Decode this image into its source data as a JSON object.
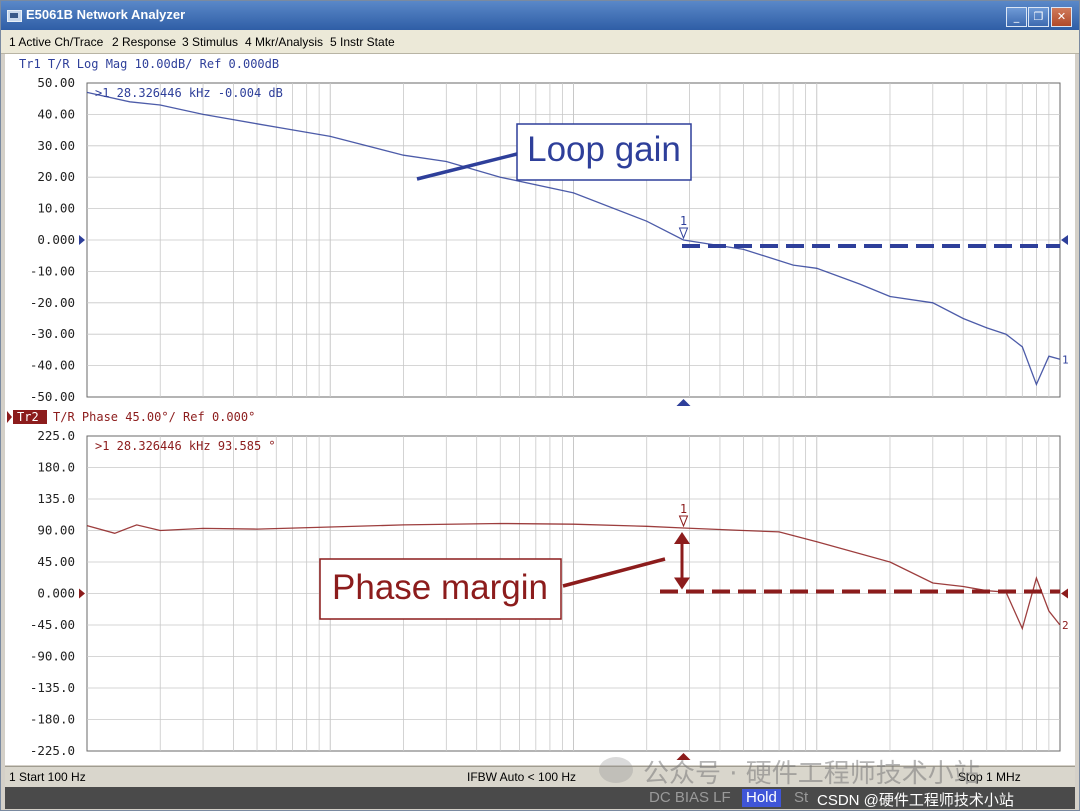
{
  "window": {
    "title": "E5061B Network Analyzer"
  },
  "menu": [
    "1 Active Ch/Trace",
    "2 Response",
    "3 Stimulus",
    "4 Mkr/Analysis",
    "5 Instr State"
  ],
  "colors": {
    "trace1": "#2e3f9a",
    "trace2": "#8c1c1c",
    "grid": "#c8c8c8"
  },
  "trace1": {
    "header": "Tr1 T/R Log Mag 10.00dB/ Ref 0.000dB",
    "marker_readout": ">1  28.326446 kHz  -0.004 dB",
    "y_ticks": [
      "50.00",
      "40.00",
      "30.00",
      "20.00",
      "10.00",
      "0.000",
      "-10.00",
      "-20.00",
      "-30.00",
      "-40.00",
      "-50.00"
    ],
    "marker_label": "1",
    "end_label": "1",
    "callout": "Loop gain"
  },
  "trace2": {
    "header_tag": "Tr2",
    "header": "T/R Phase 45.00°/ Ref 0.000°",
    "marker_readout": ">1  28.326446 kHz  93.585 °",
    "y_ticks": [
      "225.0",
      "180.0",
      "135.0",
      "90.00",
      "45.00",
      "0.000",
      "-45.00",
      "-90.00",
      "-135.0",
      "-180.0",
      "-225.0"
    ],
    "marker_label": "1",
    "end_label": "2",
    "callout": "Phase margin"
  },
  "chart_data": [
    {
      "type": "line",
      "title": "Tr1 T/R Log Mag 10.00dB/ Ref 0.000dB",
      "xscale": "log",
      "xlim": [
        100,
        1000000
      ],
      "ylim": [
        -50,
        50
      ],
      "ylabel": "",
      "grid": true,
      "series": [
        {
          "x": [
            100,
            150,
            200,
            300,
            500,
            1000,
            2000,
            3000,
            5000,
            10000,
            20000,
            28326,
            50000,
            80000,
            100000,
            150000,
            200000,
            300000,
            400000,
            500000,
            600000,
            700000,
            800000,
            900000,
            1000000
          ],
          "y": [
            47,
            44,
            43,
            40,
            37,
            33,
            27,
            25,
            20,
            15,
            6,
            0,
            -3,
            -8,
            -9,
            -14,
            -18,
            -20,
            -25,
            -28,
            -30,
            -34,
            -46,
            -37,
            -38
          ]
        }
      ],
      "marker": {
        "x": 28326.446,
        "y": -0.004
      }
    },
    {
      "type": "line",
      "title": "T/R Phase 45.00°/ Ref 0.000°",
      "xscale": "log",
      "xlim": [
        100,
        1000000
      ],
      "ylim": [
        -225,
        225
      ],
      "ylabel": "",
      "grid": true,
      "series": [
        {
          "x": [
            100,
            130,
            160,
            200,
            300,
            500,
            1000,
            2000,
            5000,
            10000,
            20000,
            28326,
            50000,
            70000,
            100000,
            200000,
            300000,
            400000,
            500000,
            600000,
            700000,
            800000,
            900000,
            1000000
          ],
          "y": [
            97,
            86,
            98,
            90,
            93,
            92,
            95,
            98,
            100,
            99,
            96,
            93.585,
            90,
            88,
            74,
            45,
            15,
            10,
            4,
            2,
            -50,
            22,
            -25,
            -45
          ]
        }
      ],
      "marker": {
        "x": 28326.446,
        "y": 93.585
      }
    }
  ],
  "status": {
    "start": "1  Start 100 Hz",
    "ifbw": "IFBW Auto < 100 Hz",
    "stop": "Stop 1 MHz"
  },
  "indicators": {
    "dcbias": "DC BIAS LF",
    "hold": "Hold",
    "extra": "St"
  },
  "watermark": {
    "wechat": "公众号 · 硬件工程师技术小站",
    "csdn": "CSDN @硬件工程师技术小站"
  }
}
